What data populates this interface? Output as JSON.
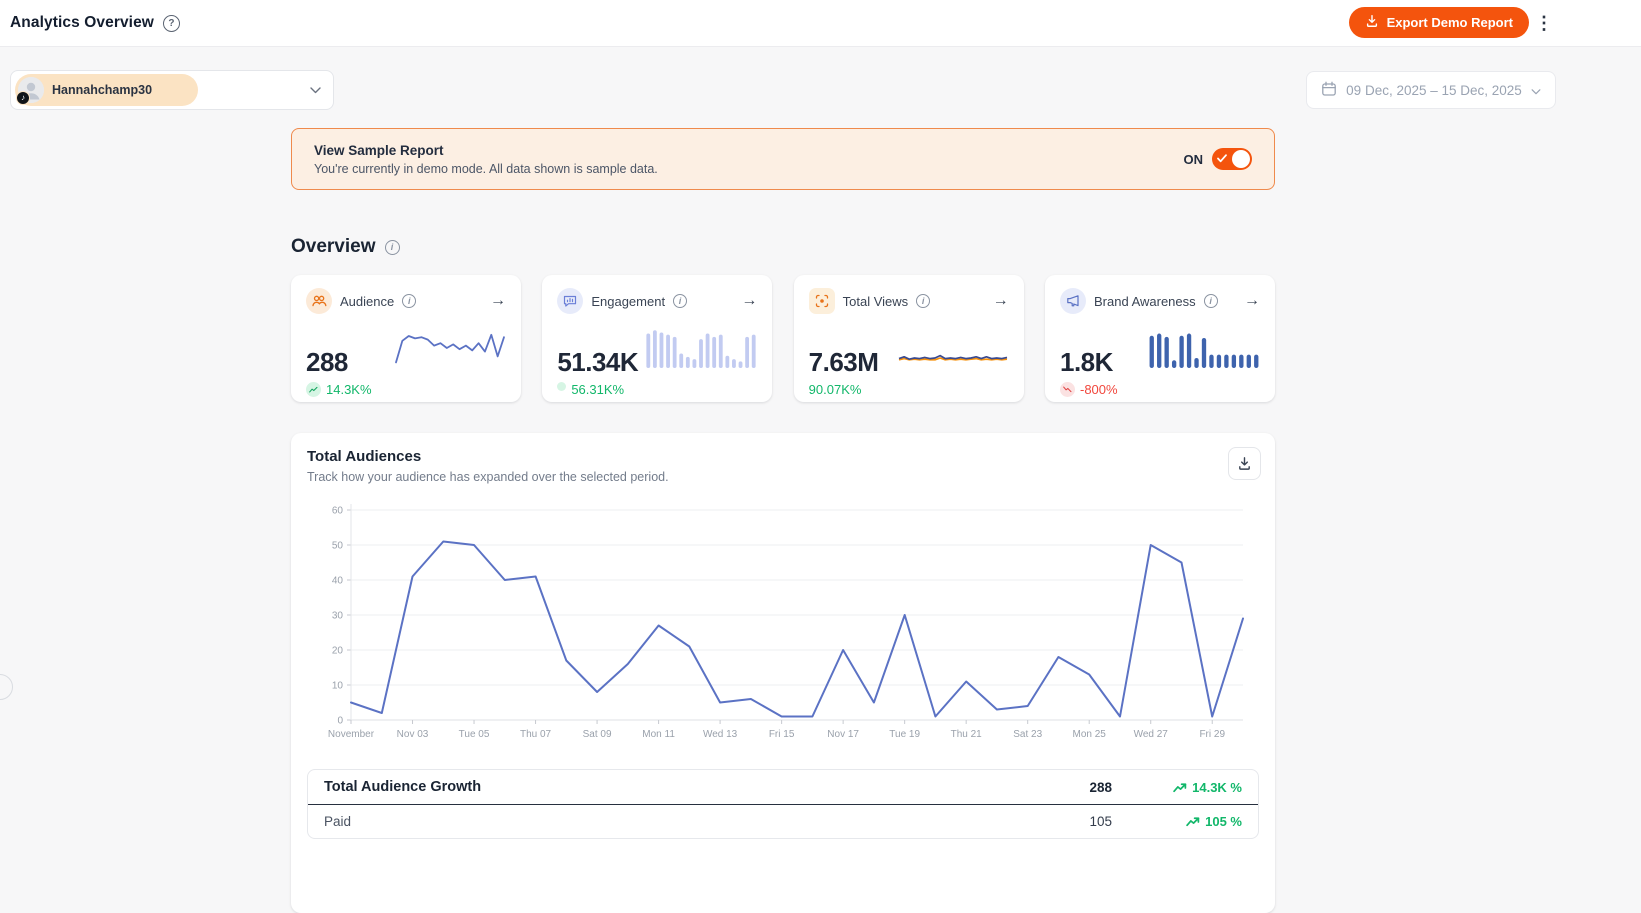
{
  "header": {
    "title": "Analytics Overview",
    "export_label": "Export Demo Report"
  },
  "toolbar": {
    "account_name": "Hannahchamp30",
    "date_range": "09 Dec, 2025 – 15 Dec, 2025"
  },
  "banner": {
    "title": "View Sample Report",
    "subtitle": "You're currently in demo mode. All data shown is sample data.",
    "toggle_label": "ON",
    "toggle_state": "on"
  },
  "overview": {
    "title": "Overview",
    "cards": [
      {
        "label": "Audience",
        "value": "288",
        "change": "14.3K%",
        "direction": "up",
        "icon": "people-icon",
        "spark": {
          "type": "line",
          "color": "#5B72C4",
          "max": 30,
          "values": [
            3,
            21,
            25,
            23,
            24,
            22,
            17,
            19,
            15,
            18,
            14,
            17,
            13,
            19,
            12,
            26,
            8,
            24
          ]
        }
      },
      {
        "label": "Engagement",
        "value": "51.34K",
        "change": "56.31K%",
        "direction": "up",
        "icon": "chat-icon",
        "spark": {
          "type": "bars",
          "color": "#C2CBF1",
          "max": 36,
          "values": [
            31,
            34,
            32,
            30,
            28,
            13,
            10,
            8,
            26,
            31,
            28,
            30,
            11,
            8,
            6,
            28,
            30
          ]
        }
      },
      {
        "label": "Total Views",
        "value": "7.63M",
        "change": "90.07K%",
        "direction": "up",
        "icon": "scan-icon",
        "spark": {
          "type": "twoline",
          "colors": [
            "#3A4A8F",
            "#F79009"
          ],
          "max": 60,
          "values": [
            9,
            12,
            8,
            10,
            9,
            11,
            9,
            10,
            14,
            9,
            10,
            9,
            11,
            9,
            10,
            12,
            9,
            12,
            9,
            10,
            9,
            11
          ],
          "values2": [
            7,
            9,
            7,
            8,
            7,
            8,
            7,
            7,
            10,
            7,
            8,
            7,
            8,
            7,
            8,
            9,
            7,
            8,
            7,
            8,
            7,
            8
          ]
        }
      },
      {
        "label": "Brand Awareness",
        "value": "1.8K",
        "change": "-800%",
        "direction": "down",
        "icon": "megaphone-icon",
        "spark": {
          "type": "bars",
          "color": "#3E63AD",
          "max": 36,
          "values": [
            29,
            31,
            28,
            7,
            29,
            31,
            9,
            27,
            12,
            12,
            12,
            12,
            12,
            12,
            12
          ]
        }
      }
    ]
  },
  "chart_card": {
    "title": "Total Audiences",
    "subtitle": "Track how your audience has expanded over the selected period."
  },
  "chart_data": {
    "type": "line",
    "title": "Total Audiences",
    "x_labels": [
      "November",
      "Nov 03",
      "Tue 05",
      "Thu 07",
      "Sat 09",
      "Mon 11",
      "Wed 13",
      "Fri 15",
      "Nov 17",
      "Tue 19",
      "Thu 21",
      "Sat 23",
      "Mon 25",
      "Wed 27",
      "Fri 29"
    ],
    "values": [
      5,
      2,
      41,
      51,
      50,
      40,
      41,
      17,
      8,
      16,
      27,
      21,
      5,
      6,
      1,
      1,
      20,
      5,
      30,
      1,
      11,
      3,
      4,
      18,
      13,
      1,
      50,
      45,
      1,
      29
    ],
    "ylim": [
      0,
      60
    ],
    "yticks": [
      0,
      10,
      20,
      30,
      40,
      50,
      60
    ],
    "line_color": "#5B72C4",
    "grid": true,
    "legend": "none"
  },
  "growth_table": {
    "rows": [
      {
        "label": "Total Audience Growth",
        "value": "288",
        "change": "14.3K %",
        "direction": "up"
      },
      {
        "label": "Paid",
        "value": "105",
        "change": "105 %",
        "direction": "up"
      }
    ]
  },
  "icons": {
    "kebab": "⋮",
    "arrow_right": "→",
    "music_note": "♪",
    "question_mark": "?",
    "info_mark": "i"
  },
  "colors": {
    "accent_orange": "#F4540D",
    "banner_bg": "#FCEFE3",
    "banner_border": "#EF8A4C",
    "positive_green": "#12B76A",
    "negative_red": "#F1473D",
    "chart_blue": "#5B72C4",
    "page_bg": "#F7F7F8"
  }
}
